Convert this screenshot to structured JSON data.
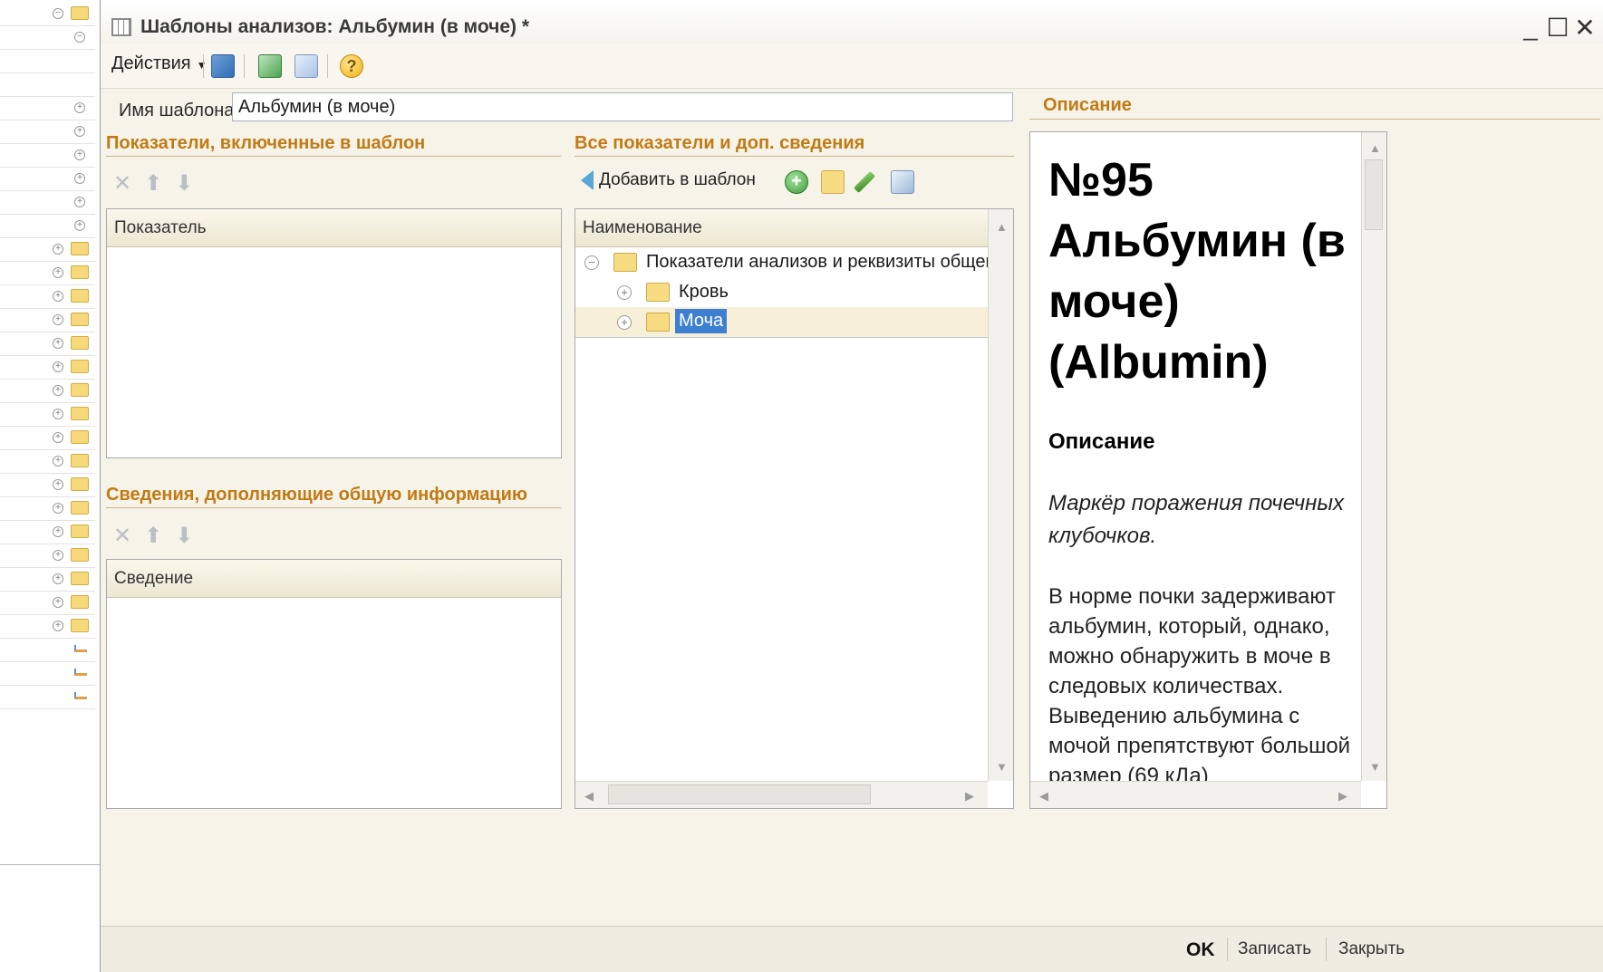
{
  "window": {
    "title": "Шаблоны анализов: Альбумин (в моче) *",
    "minimize": "_",
    "maximize": "☐",
    "close": "✕"
  },
  "toolbar": {
    "actions_label": "Действия",
    "icons": [
      "import-icon",
      "refresh-icon",
      "copy-icon",
      "help-icon"
    ]
  },
  "form": {
    "template_name_label": "Имя шаблона:",
    "template_name_value": "Альбумин (в моче)"
  },
  "included": {
    "title": "Показатели, включенные в шаблон",
    "column": "Показатель"
  },
  "extra": {
    "title": "Сведения, дополняющие общую информацию",
    "column": "Сведение"
  },
  "all": {
    "title": "Все показатели и доп. сведения",
    "add_label": "Добавить в шаблон",
    "column": "Наименование",
    "rows": [
      {
        "label": "Показатели анализов и реквизиты общег",
        "expanded": true
      },
      {
        "label": "Кровь",
        "expanded": false
      },
      {
        "label": "Моча",
        "expanded": false,
        "selected": true
      }
    ]
  },
  "description": {
    "title": "Описание",
    "heading": "№95 Альбумин (в моче) (Albumin)",
    "subheading": "Описание",
    "italic": "Маркёр поражения почечных клубочков.",
    "paragraph": "В норме почки задерживают альбумин, который, однако, можно обнаружить в моче в следовых количествах. Выведению альбумина с мочой препятствуют большой размер (69 кДа)"
  },
  "footer": {
    "ok": "OK",
    "save": "Записать",
    "close": "Закрыть"
  },
  "colors": {
    "section_title": "#c27a12",
    "selection": "#3d7fd0",
    "folder": "#f7dc82"
  }
}
